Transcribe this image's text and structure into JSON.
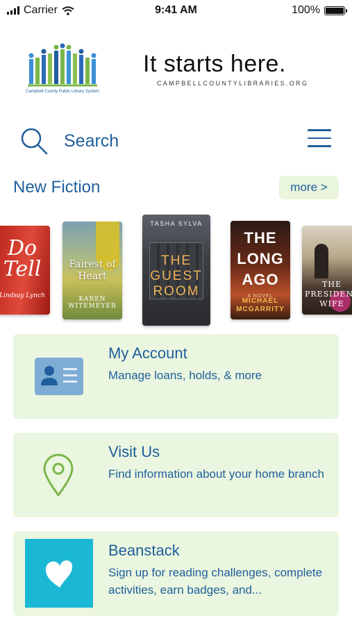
{
  "status": {
    "carrier": "Carrier",
    "time": "9:41 AM",
    "battery": "100%"
  },
  "header": {
    "logo_caption": "Campbell County Public Library System",
    "tagline": "It starts here.",
    "url": "CAMPBELLCOUNTYLIBRARIES.ORG"
  },
  "search": {
    "label": "Search"
  },
  "new_fiction": {
    "title": "New Fiction",
    "more": "more >",
    "books": [
      {
        "title": "Do Tell",
        "author": "Lindsay Lynch"
      },
      {
        "title": "Fairest of Heart",
        "author": "Karen Witemeyer"
      },
      {
        "title": "The Guest Room",
        "author": "Tasha Sylva"
      },
      {
        "title": "The Long Ago",
        "author": "Michael McGarrity",
        "tag": "A NOVEL"
      },
      {
        "title": "The President's Wife",
        "author": ""
      }
    ]
  },
  "cards": {
    "account": {
      "title": "My Account",
      "desc": "Manage loans, holds, & more"
    },
    "visit": {
      "title": "Visit Us",
      "desc": "Find information about your home branch"
    },
    "beanstack": {
      "title": "Beanstack",
      "desc": "Sign up for reading challenges, complete activities, earn badges, and..."
    }
  }
}
